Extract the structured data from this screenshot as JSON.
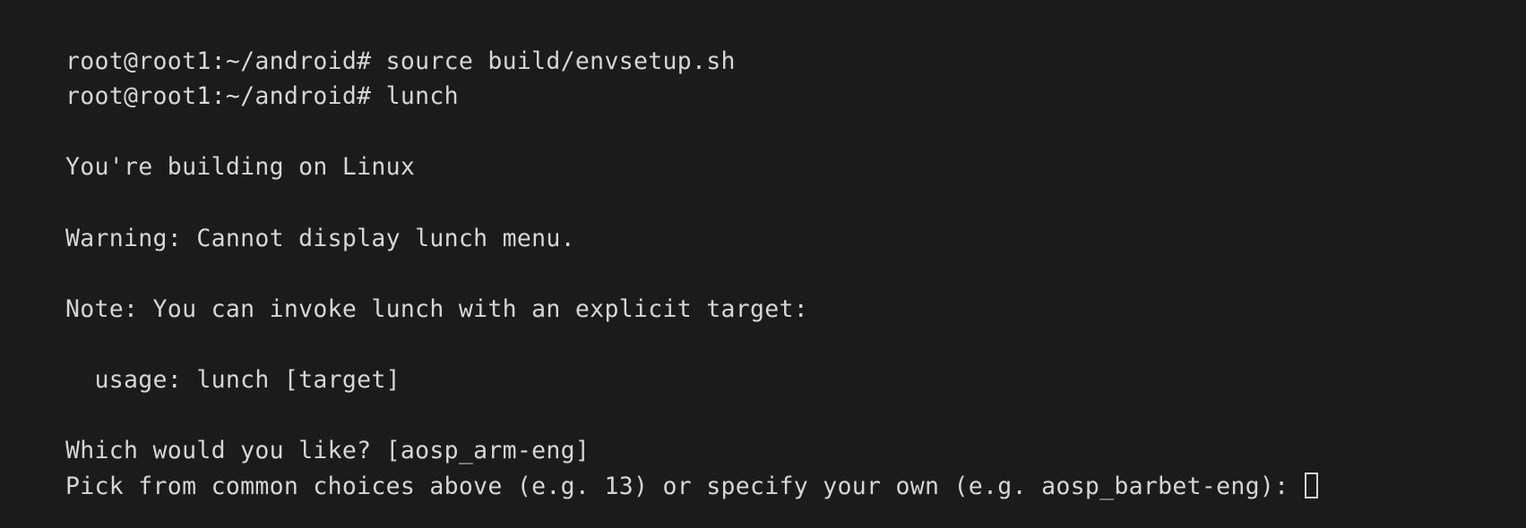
{
  "terminal": {
    "background_color": "#1b1b1b",
    "foreground_color": "#d6d6d6",
    "prompt": "root@root1:~/android#",
    "cursor": {
      "style": "hollow-block",
      "color": "#d6d6d6"
    },
    "lines": [
      {
        "text": "root@root1:~/android# source build/envsetup.sh",
        "blank": false,
        "cursor": false
      },
      {
        "text": "root@root1:~/android# lunch",
        "blank": false,
        "cursor": false
      },
      {
        "text": "",
        "blank": true,
        "cursor": false
      },
      {
        "text": "You're building on Linux",
        "blank": false,
        "cursor": false
      },
      {
        "text": "",
        "blank": true,
        "cursor": false
      },
      {
        "text": "Warning: Cannot display lunch menu.",
        "blank": false,
        "cursor": false
      },
      {
        "text": "",
        "blank": true,
        "cursor": false
      },
      {
        "text": "Note: You can invoke lunch with an explicit target:",
        "blank": false,
        "cursor": false
      },
      {
        "text": "",
        "blank": true,
        "cursor": false
      },
      {
        "text": "  usage: lunch [target]",
        "blank": false,
        "cursor": false
      },
      {
        "text": "",
        "blank": true,
        "cursor": false
      },
      {
        "text": "Which would you like? [aosp_arm-eng]",
        "blank": false,
        "cursor": false
      },
      {
        "text": "Pick from common choices above (e.g. 13) or specify your own (e.g. aosp_barbet-eng): ",
        "blank": false,
        "cursor": true
      }
    ]
  }
}
